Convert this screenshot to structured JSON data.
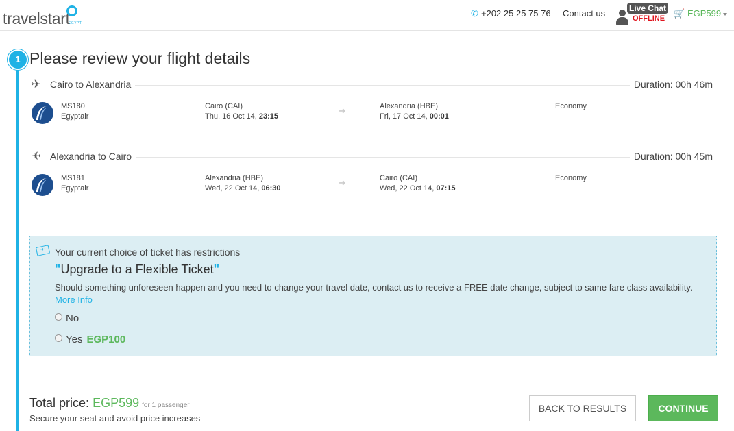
{
  "brand": {
    "name": "travelstart",
    "sub": "EGYPT"
  },
  "header": {
    "phone": "+202 25 25 75 76",
    "contact": "Contact us",
    "livechat_label": "Live Chat",
    "livechat_status": "OFFLINE",
    "cart_amount": "EGP599"
  },
  "step": {
    "number": "1",
    "title": "Please review your flight details"
  },
  "flights": [
    {
      "route": "Cairo to Alexandria",
      "duration": "Duration: 00h 46m",
      "flight_no": "MS180",
      "carrier": "Egyptair",
      "from_airport": "Cairo (CAI)",
      "from_date": "Thu, 16 Oct 14,",
      "from_time": "23:15",
      "to_airport": "Alexandria (HBE)",
      "to_date": "Fri, 17 Oct 14,",
      "to_time": "00:01",
      "cabin": "Economy"
    },
    {
      "route": "Alexandria to Cairo",
      "duration": "Duration: 00h 45m",
      "flight_no": "MS181",
      "carrier": "Egyptair",
      "from_airport": "Alexandria (HBE)",
      "from_date": "Wed, 22 Oct 14,",
      "from_time": "06:30",
      "to_airport": "Cairo (CAI)",
      "to_date": "Wed, 22 Oct 14,",
      "to_time": "07:15",
      "cabin": "Economy"
    }
  ],
  "upsell": {
    "restriction": "Your current choice of ticket has restrictions",
    "title": "Upgrade to a Flexible Ticket",
    "description": "Should something unforeseen happen and you need to change your travel date, contact us to receive a FREE date change, subject to same fare class availability.",
    "more_info": "More Info",
    "option_no": "No",
    "option_yes": "Yes",
    "option_yes_price": "EGP100"
  },
  "footer": {
    "total_label": "Total price:",
    "total_amount": "EGP599",
    "total_pax": "for 1 passenger",
    "secure": "Secure your seat and avoid price increases",
    "back_button": "BACK TO RESULTS",
    "continue_button": "CONTINUE"
  },
  "colors": {
    "accent": "#1fb2e5",
    "green": "#5cb85c",
    "offline": "#e0141e",
    "panel": "#dceef3"
  }
}
